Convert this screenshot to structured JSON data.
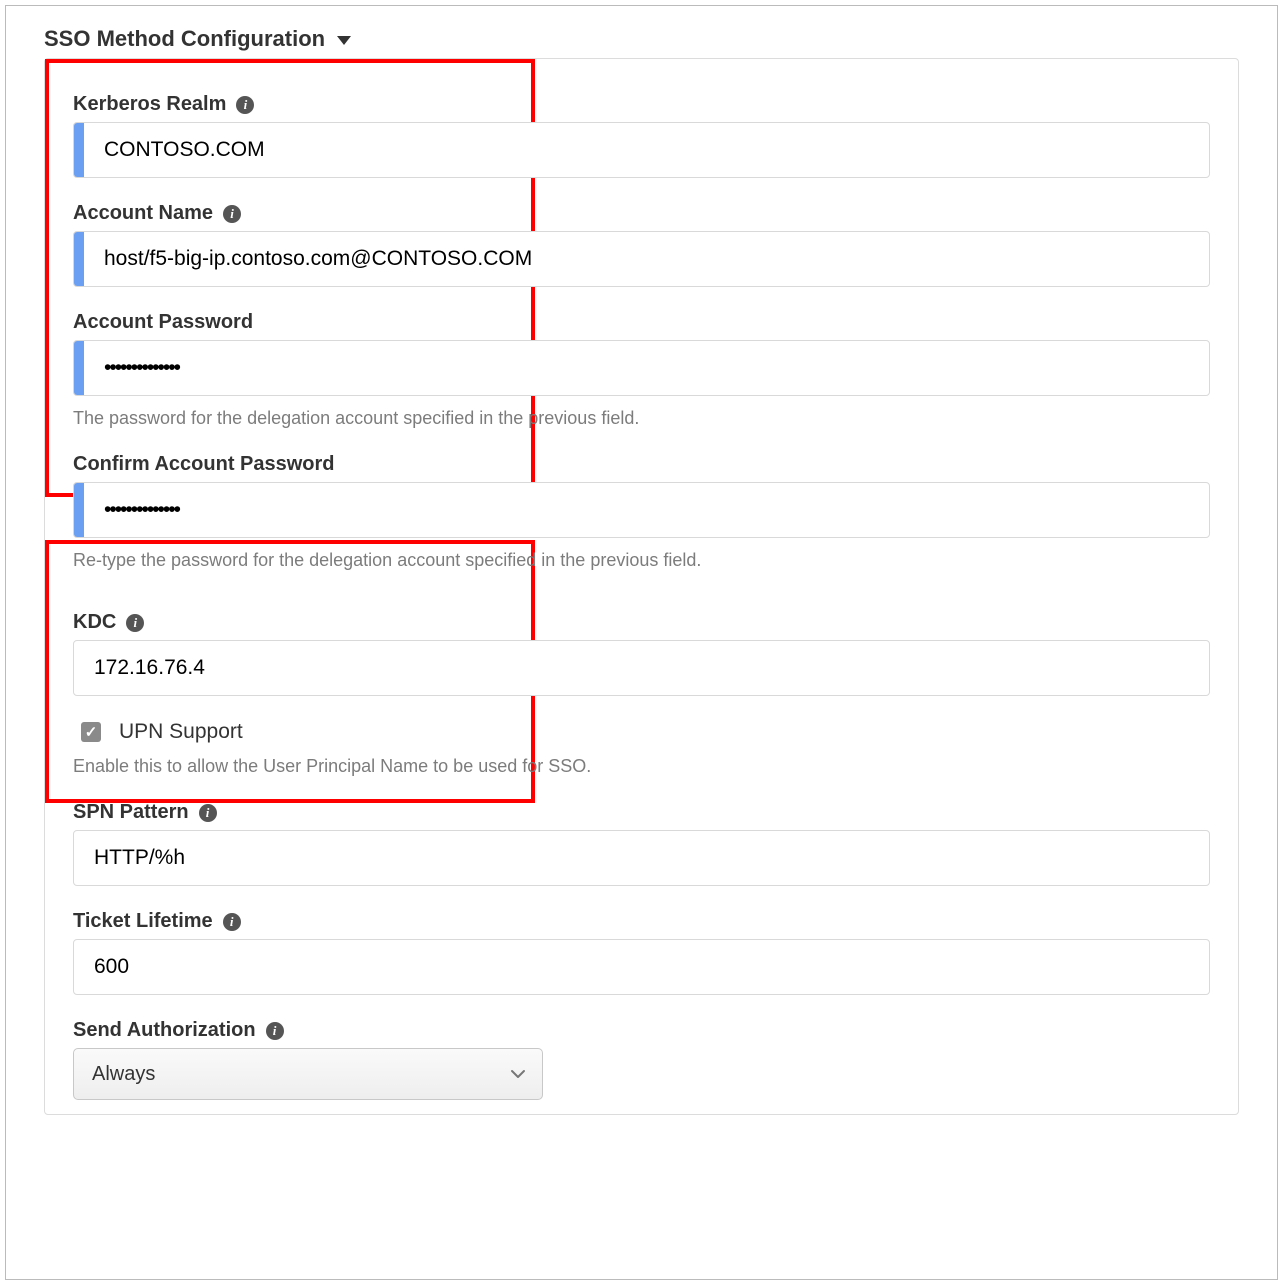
{
  "sectionTitle": "SSO Method Configuration",
  "fields": {
    "kerberosRealm": {
      "label": "Kerberos Realm",
      "value": "CONTOSO.COM"
    },
    "accountName": {
      "label": "Account Name",
      "value": "host/f5-big-ip.contoso.com@CONTOSO.COM"
    },
    "accountPassword": {
      "label": "Account Password",
      "value": "",
      "help": "The password for the delegation account specified in the previous field."
    },
    "confirmPassword": {
      "label": "Confirm Account Password",
      "value": "",
      "help": "Re-type the password for the delegation account specified in the previous field."
    },
    "kdc": {
      "label": "KDC",
      "value": "172.16.76.4"
    },
    "upnSupport": {
      "label": "UPN Support",
      "checked": true,
      "help": "Enable this to allow the User Principal Name to be used for SSO."
    },
    "spnPattern": {
      "label": "SPN Pattern",
      "value": "HTTP/%h"
    },
    "ticketLifetime": {
      "label": "Ticket Lifetime",
      "value": "600"
    },
    "sendAuthorization": {
      "label": "Send Authorization",
      "value": "Always"
    }
  },
  "passwordMask": "••••••••••••••"
}
